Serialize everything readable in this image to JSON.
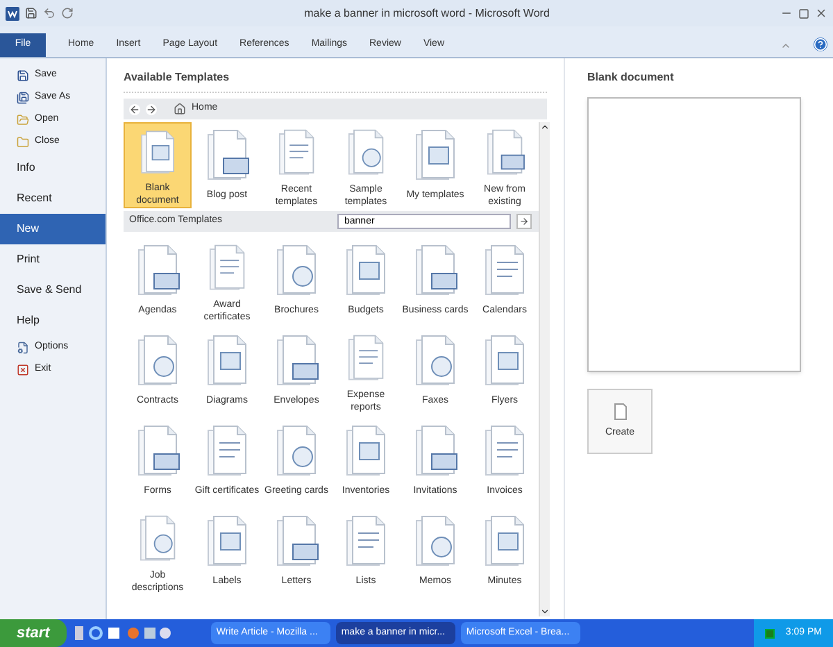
{
  "window": {
    "title": "make a banner in microsoft word - Microsoft Word"
  },
  "ribbon": {
    "file_tab": {
      "label": "File"
    },
    "tabs": [
      {
        "label": "Home"
      },
      {
        "label": "Insert"
      },
      {
        "label": "Page Layout"
      },
      {
        "label": "References"
      },
      {
        "label": "Mailings"
      },
      {
        "label": "Review"
      },
      {
        "label": "View"
      }
    ]
  },
  "sidebar": {
    "items": [
      {
        "kind": "command",
        "label": "Save",
        "selected": false
      },
      {
        "kind": "command",
        "label": "Save As",
        "selected": false
      },
      {
        "kind": "command",
        "label": "Open",
        "selected": false
      },
      {
        "kind": "command",
        "label": "Close",
        "selected": false
      },
      {
        "kind": "section",
        "label": "Info",
        "selected": false
      },
      {
        "kind": "section",
        "label": "Recent",
        "selected": false
      },
      {
        "kind": "section",
        "label": "New",
        "selected": true
      },
      {
        "kind": "section",
        "label": "Print",
        "selected": false
      },
      {
        "kind": "section",
        "label": "Save & Send",
        "selected": false
      },
      {
        "kind": "section",
        "label": "Help",
        "selected": false
      },
      {
        "kind": "command",
        "label": "Options",
        "selected": false
      },
      {
        "kind": "command",
        "label": "Exit",
        "selected": false
      }
    ]
  },
  "templates": {
    "title": "Available Templates",
    "nav": {
      "home": "Home"
    },
    "top": [
      {
        "label": "Blank document",
        "selected": true
      },
      {
        "label": "Blog post",
        "selected": false
      },
      {
        "label": "Recent templates",
        "selected": false
      },
      {
        "label": "Sample templates",
        "selected": false
      },
      {
        "label": "My templates",
        "selected": false
      },
      {
        "label": "New from existing",
        "selected": false
      }
    ],
    "office_com": {
      "label": "Office.com Templates",
      "search": "banner"
    },
    "grid": [
      "Agendas",
      "Award certificates",
      "Brochures",
      "Budgets",
      "Business cards",
      "Calendars",
      "Contracts",
      "Diagrams",
      "Envelopes",
      "Expense reports",
      "Faxes",
      "Flyers",
      "Forms",
      "Gift certificates",
      "Greeting cards",
      "Inventories",
      "Invitations",
      "Invoices",
      "Job descriptions",
      "Labels",
      "Letters",
      "Lists",
      "Memos",
      "Minutes"
    ]
  },
  "preview": {
    "title": "Blank document",
    "create": "Create"
  },
  "taskbar": {
    "start": "start",
    "tasks": [
      {
        "label": "Write Article - Mozilla ...",
        "selected": false
      },
      {
        "label": "make a banner in micr...",
        "selected": true
      },
      {
        "label": "Microsoft Excel - Brea...",
        "selected": false
      }
    ],
    "clock": "3:09 PM"
  }
}
